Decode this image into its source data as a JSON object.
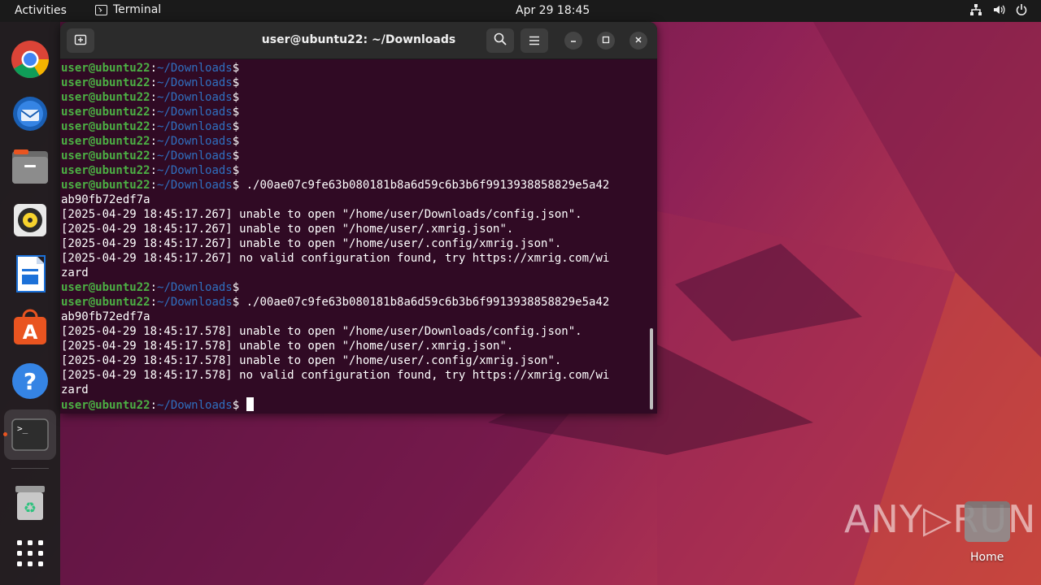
{
  "topbar": {
    "activities": "Activities",
    "app_name": "Terminal",
    "clock": "Apr 29  18:45"
  },
  "dock": {
    "items": [
      {
        "name": "chrome"
      },
      {
        "name": "thunderbird"
      },
      {
        "name": "files"
      },
      {
        "name": "rhythmbox"
      },
      {
        "name": "libreoffice-writer"
      },
      {
        "name": "app-center"
      },
      {
        "name": "help"
      },
      {
        "name": "terminal"
      },
      {
        "name": "trash"
      },
      {
        "name": "show-apps"
      }
    ]
  },
  "terminal": {
    "title": "user@ubuntu22: ~/Downloads",
    "prompt_user": "user@ubuntu22",
    "prompt_colon": ":",
    "prompt_path": "~/Downloads",
    "prompt_symbol": "$",
    "lines": [
      {
        "prompt": true,
        "cmd": ""
      },
      {
        "prompt": true,
        "cmd": ""
      },
      {
        "prompt": true,
        "cmd": ""
      },
      {
        "prompt": true,
        "cmd": ""
      },
      {
        "prompt": true,
        "cmd": ""
      },
      {
        "prompt": true,
        "cmd": ""
      },
      {
        "prompt": true,
        "cmd": ""
      },
      {
        "prompt": true,
        "cmd": ""
      },
      {
        "prompt": true,
        "cmd": " ./00ae07c9fe63b080181b8a6d59c6b3b6f9913938858829e5a42"
      },
      {
        "prompt": false,
        "text": "ab90fb72edf7a"
      },
      {
        "prompt": false,
        "text": "[2025-04-29 18:45:17.267] unable to open \"/home/user/Downloads/config.json\"."
      },
      {
        "prompt": false,
        "text": "[2025-04-29 18:45:17.267] unable to open \"/home/user/.xmrig.json\"."
      },
      {
        "prompt": false,
        "text": "[2025-04-29 18:45:17.267] unable to open \"/home/user/.config/xmrig.json\"."
      },
      {
        "prompt": false,
        "text": "[2025-04-29 18:45:17.267] no valid configuration found, try https://xmrig.com/wi"
      },
      {
        "prompt": false,
        "text": "zard"
      },
      {
        "prompt": true,
        "cmd": ""
      },
      {
        "prompt": true,
        "cmd": " ./00ae07c9fe63b080181b8a6d59c6b3b6f9913938858829e5a42"
      },
      {
        "prompt": false,
        "text": "ab90fb72edf7a"
      },
      {
        "prompt": false,
        "text": "[2025-04-29 18:45:17.578] unable to open \"/home/user/Downloads/config.json\"."
      },
      {
        "prompt": false,
        "text": "[2025-04-29 18:45:17.578] unable to open \"/home/user/.xmrig.json\"."
      },
      {
        "prompt": false,
        "text": "[2025-04-29 18:45:17.578] unable to open \"/home/user/.config/xmrig.json\"."
      },
      {
        "prompt": false,
        "text": "[2025-04-29 18:45:17.578] no valid configuration found, try https://xmrig.com/wi"
      },
      {
        "prompt": false,
        "text": "zard"
      },
      {
        "prompt": true,
        "cmd": " ",
        "cursor": true
      }
    ]
  },
  "desktop": {
    "watermark": "ANY▷RUN",
    "home_label": "Home"
  },
  "colors": {
    "terminal_bg": "#300a24",
    "prompt_user": "#4cb044",
    "prompt_path": "#2f6fbf",
    "accent": "#e95420"
  }
}
